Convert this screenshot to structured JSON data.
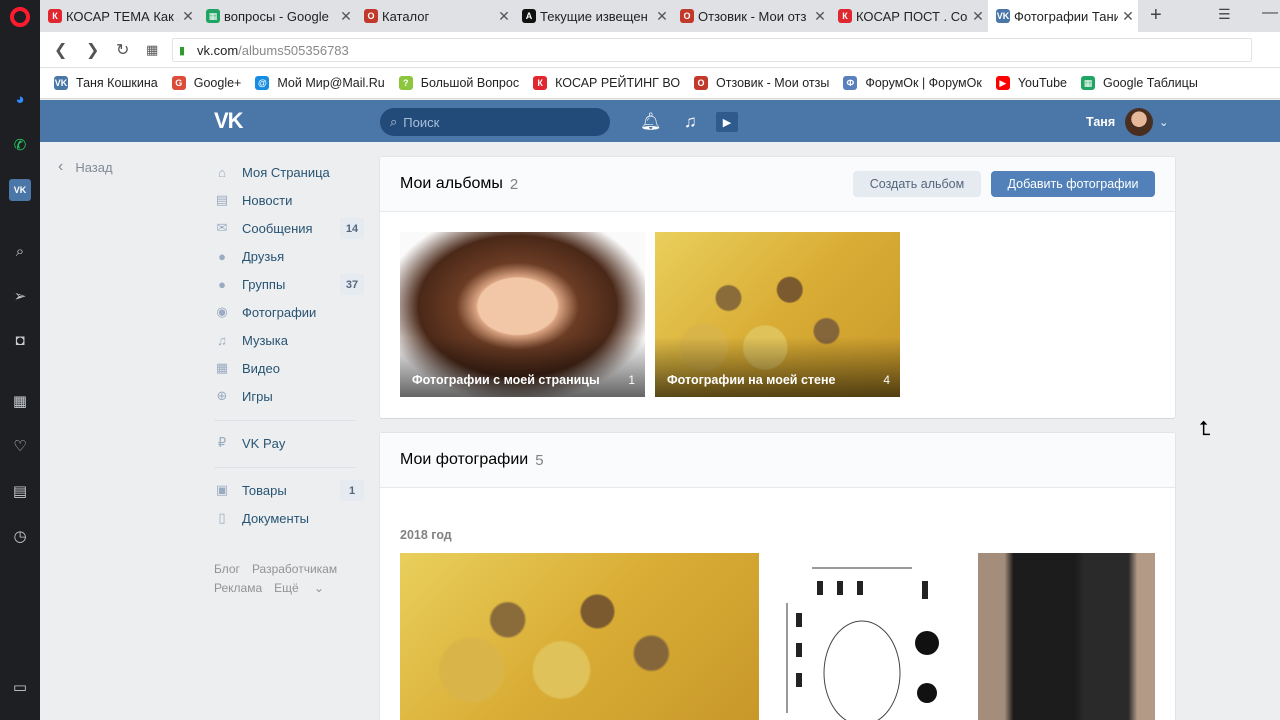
{
  "browser": {
    "tabs": [
      {
        "title": "КОСАР ТЕМА Как з",
        "icon": "kosar-icon",
        "color": "#e0262f",
        "letter": "К"
      },
      {
        "title": "вопросы - Google",
        "icon": "sheets-icon",
        "color": "#20a464",
        "letter": "▦"
      },
      {
        "title": "Каталог",
        "icon": "otzovik-icon",
        "color": "#c0392b",
        "letter": "O"
      },
      {
        "title": "Текущие извещен",
        "icon": "a-icon",
        "color": "#111111",
        "letter": "A"
      },
      {
        "title": "Отзовик - Мои отз",
        "icon": "otzovik-icon",
        "color": "#c0392b",
        "letter": "O"
      },
      {
        "title": "КОСАР ПОСТ . Соз",
        "icon": "kosar-icon",
        "color": "#e0262f",
        "letter": "К"
      },
      {
        "title": "Фотографии Тани",
        "icon": "vk-icon",
        "color": "#4a76a8",
        "letter": "VK"
      }
    ],
    "url_host": "vk.com",
    "url_path": "/albums505356783",
    "bookmarks": [
      {
        "label": "Таня Кошкина",
        "color": "#4a76a8",
        "letter": "VK"
      },
      {
        "label": "Google+",
        "color": "#dd4b39",
        "letter": "G"
      },
      {
        "label": "Мой Мир@Mail.Ru",
        "color": "#168de2",
        "letter": "@"
      },
      {
        "label": "Большой Вопрос",
        "color": "#8cc63f",
        "letter": "?"
      },
      {
        "label": "КОСАР РЕЙТИНГ ВО",
        "color": "#e0262f",
        "letter": "К"
      },
      {
        "label": "Отзовик - Мои отзы",
        "color": "#c0392b",
        "letter": "O"
      },
      {
        "label": "ФорумОк | ФорумОк",
        "color": "#5a7fbf",
        "letter": "Ф"
      },
      {
        "label": "YouTube",
        "color": "#ff0000",
        "letter": "▶"
      },
      {
        "label": "Google Таблицы",
        "color": "#20a464",
        "letter": "▦"
      }
    ]
  },
  "vk": {
    "search_placeholder": "Поиск",
    "user_name": "Таня",
    "back_label": "Назад",
    "menu": [
      {
        "label": "Моя Страница",
        "icon": "home-icon",
        "glyph": "⌂",
        "badge": ""
      },
      {
        "label": "Новости",
        "icon": "news-icon",
        "glyph": "▤",
        "badge": ""
      },
      {
        "label": "Сообщения",
        "icon": "messages-icon",
        "glyph": "✉",
        "badge": "14"
      },
      {
        "label": "Друзья",
        "icon": "friends-icon",
        "glyph": "●",
        "badge": ""
      },
      {
        "label": "Группы",
        "icon": "groups-icon",
        "glyph": "●",
        "badge": "37"
      },
      {
        "label": "Фотографии",
        "icon": "camera-icon",
        "glyph": "◉",
        "badge": ""
      },
      {
        "label": "Музыка",
        "icon": "music-icon",
        "glyph": "♫",
        "badge": ""
      },
      {
        "label": "Видео",
        "icon": "video-icon",
        "glyph": "▦",
        "badge": ""
      },
      {
        "label": "Игры",
        "icon": "games-icon",
        "glyph": "⊕",
        "badge": ""
      }
    ],
    "vkpay": {
      "label": "VK Pay",
      "icon": "ruble-icon",
      "glyph": "₽"
    },
    "menu2": [
      {
        "label": "Товары",
        "icon": "bag-icon",
        "glyph": "▣",
        "badge": "1"
      },
      {
        "label": "Документы",
        "icon": "document-icon",
        "glyph": "▯",
        "badge": ""
      }
    ],
    "footer": {
      "blog": "Блог",
      "dev": "Разработчикам",
      "ads": "Реклама",
      "more": "Ещё"
    }
  },
  "albums": {
    "title": "Мои альбомы",
    "count": "2",
    "create_label": "Создать альбом",
    "add_label": "Добавить фотографии",
    "items": [
      {
        "name": "Фотографии с моей страницы",
        "count": "1"
      },
      {
        "name": "Фотографии на моей стене",
        "count": "4"
      }
    ]
  },
  "photos": {
    "title": "Мои фотографии",
    "count": "5",
    "year": "2018 год"
  }
}
